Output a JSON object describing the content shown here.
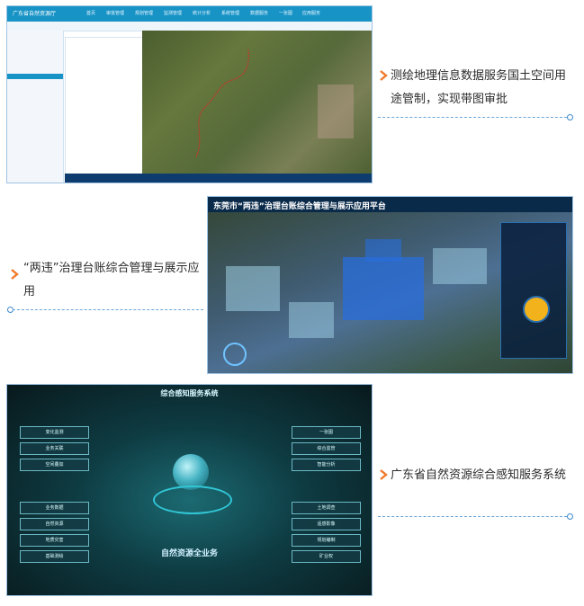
{
  "panel1": {
    "caption": "测绘地理信息数据服务国土空间用途管制，实现带图审批",
    "app_title": "广东省自然资源厅",
    "nav_items": [
      "首页",
      "审批管理",
      "规划管理",
      "监测管理",
      "统计分析",
      "系统管理",
      "数据服务",
      "一张图",
      "应用服务"
    ]
  },
  "panel2": {
    "caption": "“两违”治理台账综合管理与展示应用",
    "app_title": "东莞市“两违”治理台账综合管理与展示应用平台"
  },
  "panel3": {
    "caption": "广东省自然资源综合感知服务系统",
    "app_title": "综合感知服务系统",
    "footer": "自然资源全业务",
    "left_buttons": [
      "变化监测",
      "业务关联",
      "空间叠加",
      "业务数据",
      "自然资源",
      "地质灾害",
      "基础测绘"
    ],
    "right_buttons": [
      "一张图",
      "综合监管",
      "智能分析",
      "土地调查",
      "遥感影像",
      "规划编制",
      "矿业权"
    ]
  },
  "colors": {
    "accent": "#1793c6",
    "arrow": "#f07a2a",
    "border": "#9fc3e3"
  }
}
